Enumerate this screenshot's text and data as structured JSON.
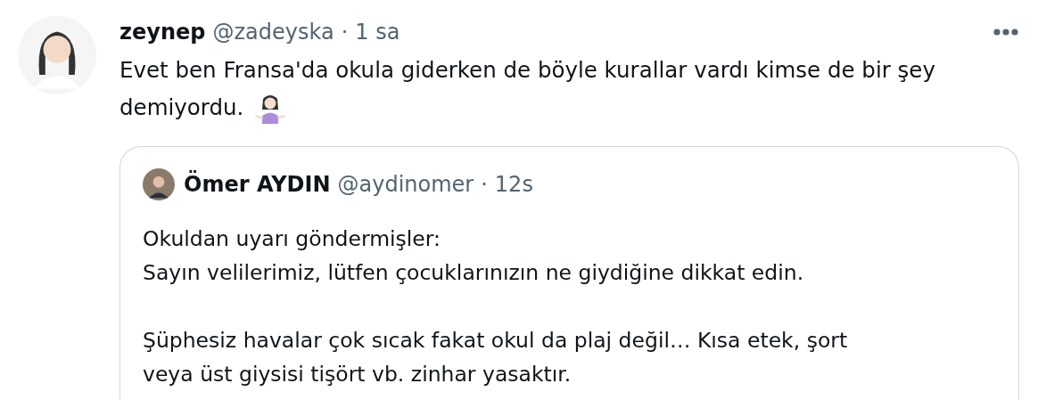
{
  "tweet": {
    "author": {
      "name": "zeynep",
      "handle": "@zadeyska",
      "separator": "·",
      "time": "1 sa"
    },
    "text_lines": [
      "Evet ben Fransa'da okula giderken de böyle kurallar vardı kimse de bir şey",
      "demiyordu."
    ],
    "emoji": {
      "kind": "shrug"
    },
    "quoted": {
      "author": {
        "name": "Ömer AYDIN",
        "handle": "@aydinomer",
        "separator": "·",
        "time": "12s"
      },
      "paragraphs": [
        "Okuldan uyarı göndermişler:\nSayın velilerimiz, lütfen çocuklarınızın ne giydiğine dikkat edin.",
        "Şüphesiz havalar çok sıcak fakat okul da plaj değil… Kısa etek, şort\nveya üst giysisi tişört vb. zinhar yasaktır."
      ]
    }
  }
}
